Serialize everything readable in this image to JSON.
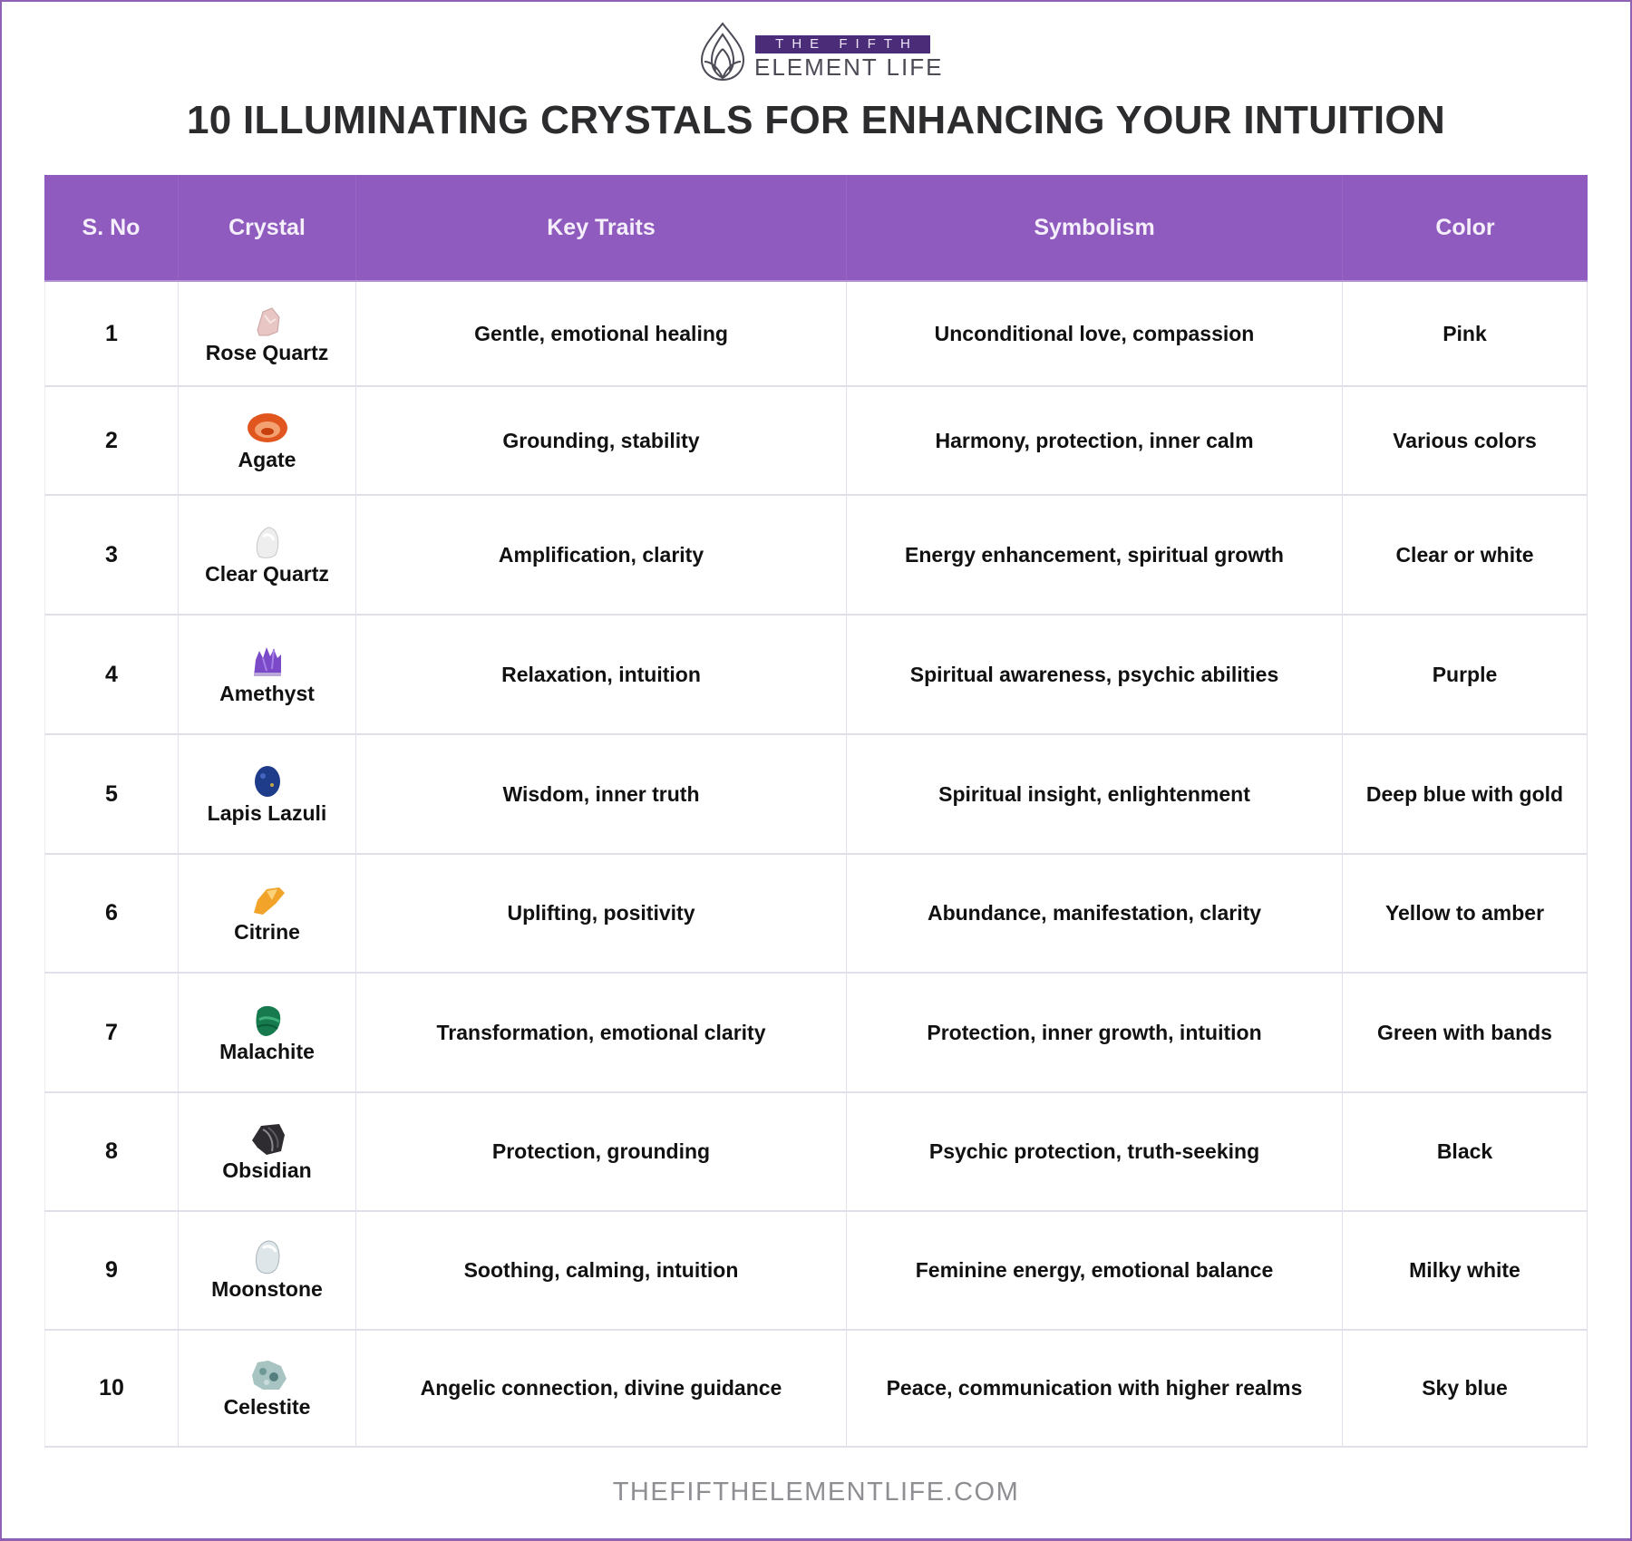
{
  "logo": {
    "icon": "lotus-drop-icon",
    "band_text": "THE FIFTH",
    "sub_text": "ELEMENT LIFE"
  },
  "title": "10 ILLUMINATING CRYSTALS FOR ENHANCING YOUR INTUITION",
  "table": {
    "headers": [
      "S. No",
      "Crystal",
      "Key Traits",
      "Symbolism",
      "Color"
    ],
    "rows": [
      {
        "no": "1",
        "crystal": "Rose Quartz",
        "image": "rose-quartz-image",
        "traits": "Gentle, emotional healing",
        "symbolism": "Unconditional love, compassion",
        "color": "Pink"
      },
      {
        "no": "2",
        "crystal": "Agate",
        "image": "agate-image",
        "traits": "Grounding, stability",
        "symbolism": "Harmony, protection, inner calm",
        "color": "Various colors"
      },
      {
        "no": "3",
        "crystal": "Clear Quartz",
        "image": "clear-quartz-image",
        "traits": "Amplification, clarity",
        "symbolism": "Energy enhancement, spiritual growth",
        "color": "Clear or white"
      },
      {
        "no": "4",
        "crystal": "Amethyst",
        "image": "amethyst-image",
        "traits": "Relaxation, intuition",
        "symbolism": "Spiritual awareness, psychic abilities",
        "color": "Purple"
      },
      {
        "no": "5",
        "crystal": "Lapis Lazuli",
        "image": "lapis-lazuli-image",
        "traits": "Wisdom, inner truth",
        "symbolism": "Spiritual insight, enlightenment",
        "color": "Deep blue with gold"
      },
      {
        "no": "6",
        "crystal": "Citrine",
        "image": "citrine-image",
        "traits": "Uplifting, positivity",
        "symbolism": "Abundance, manifestation, clarity",
        "color": "Yellow to amber"
      },
      {
        "no": "7",
        "crystal": "Malachite",
        "image": "malachite-image",
        "traits": "Transformation, emotional clarity",
        "symbolism": "Protection, inner growth, intuition",
        "color": "Green with bands"
      },
      {
        "no": "8",
        "crystal": "Obsidian",
        "image": "obsidian-image",
        "traits": "Protection, grounding",
        "symbolism": "Psychic protection, truth-seeking",
        "color": "Black"
      },
      {
        "no": "9",
        "crystal": "Moonstone",
        "image": "moonstone-image",
        "traits": "Soothing, calming, intuition",
        "symbolism": "Feminine energy, emotional balance",
        "color": "Milky white"
      },
      {
        "no": "10",
        "crystal": "Celestite",
        "image": "celestite-image",
        "traits": "Angelic connection, divine guidance",
        "symbolism": "Peace, communication with higher realms",
        "color": "Sky blue"
      }
    ]
  },
  "footer": "THEFIFTHELEMENTLIFE.COM",
  "colors": {
    "header_bg": "#905bbe",
    "frame": "#8d62b5",
    "logo_band": "#4a2c78",
    "title": "#2c2c2e",
    "footer": "#8f8f93"
  }
}
